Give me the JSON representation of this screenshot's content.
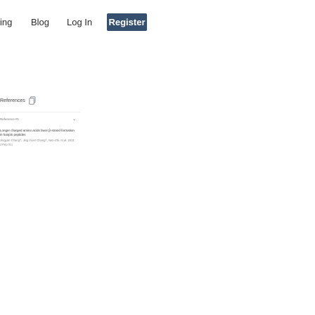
{
  "nav": {
    "links": [
      {
        "label": "ing"
      },
      {
        "label": "Blog"
      },
      {
        "label": "Log In"
      }
    ],
    "register_label": "Register"
  },
  "references": {
    "header": "References",
    "items": [
      {
        "label": "Reference #1",
        "title": "Longer charged amino acids favor β-strand formation in hairpin peptides",
        "authors": "Jingyan Chang†, Jing Yuan Chang†, Nan-Zhi, et al. 2021 J Pep Sci"
      }
    ]
  }
}
